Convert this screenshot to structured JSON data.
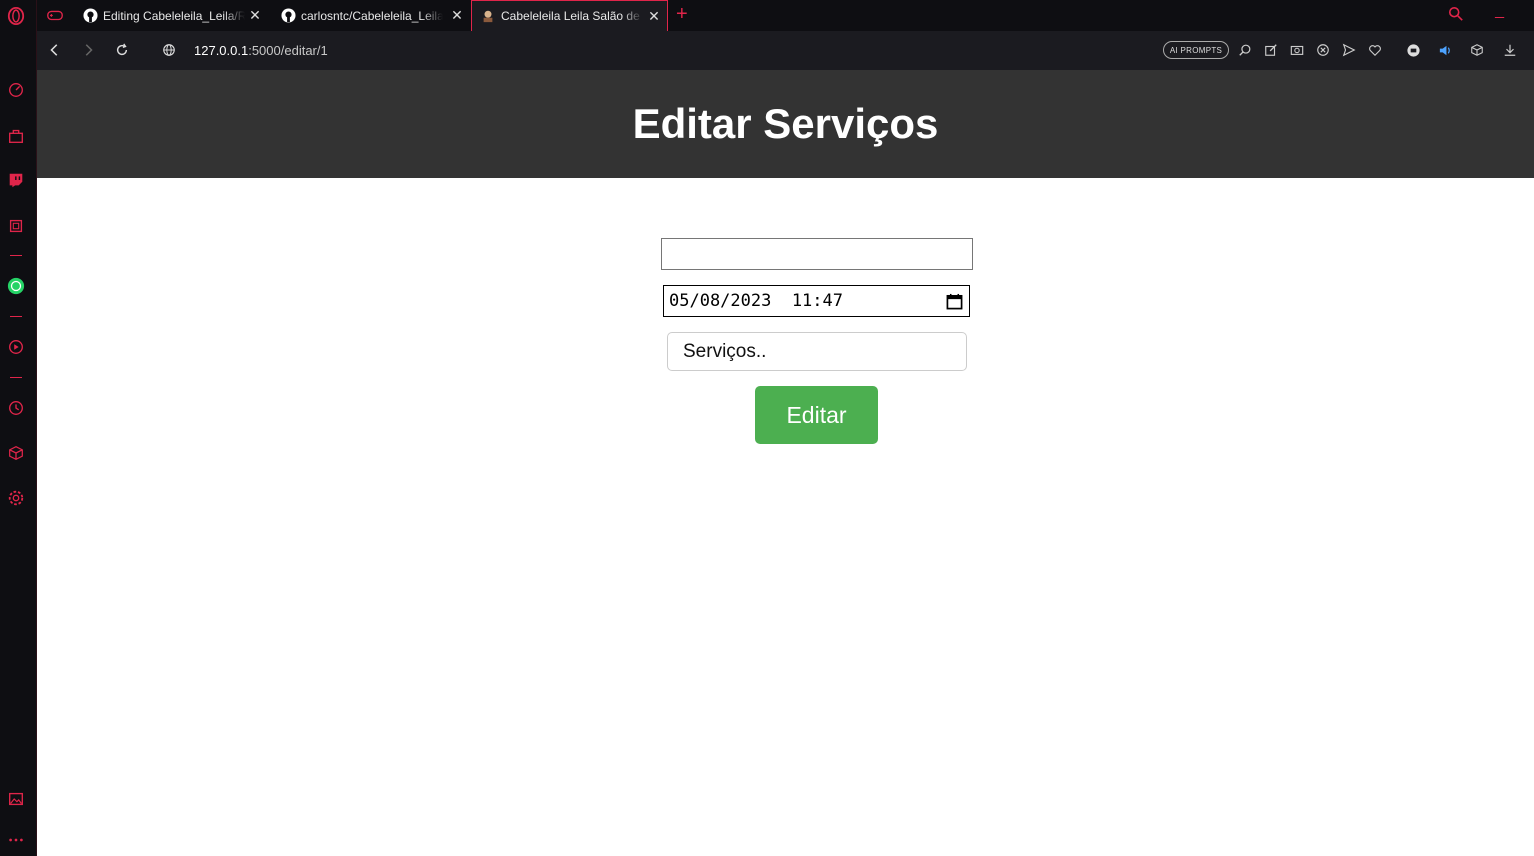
{
  "browser": {
    "tabs": [
      {
        "title": "Editing Cabeleleila_Leila/README.md",
        "favicon": "github-icon"
      },
      {
        "title": "carlosntc/Cabeleleila_Leila",
        "favicon": "github-icon"
      },
      {
        "title": "Cabeleleila Leila Salão de Beleza",
        "favicon": "site-favicon",
        "active": true
      }
    ],
    "url_host": "127.0.0.1",
    "url_rest": ":5000/editar/1",
    "ai_prompts_label": "AI PROMPTS",
    "accent_color": "#e0254a"
  },
  "page": {
    "title": "Editar Serviços",
    "name_input_value": "",
    "datetime_value": "05/08/2023  11:47",
    "service_select_value": "Serviços..",
    "submit_label": "Editar",
    "header_color": "#333333",
    "button_color": "#4caf50"
  }
}
